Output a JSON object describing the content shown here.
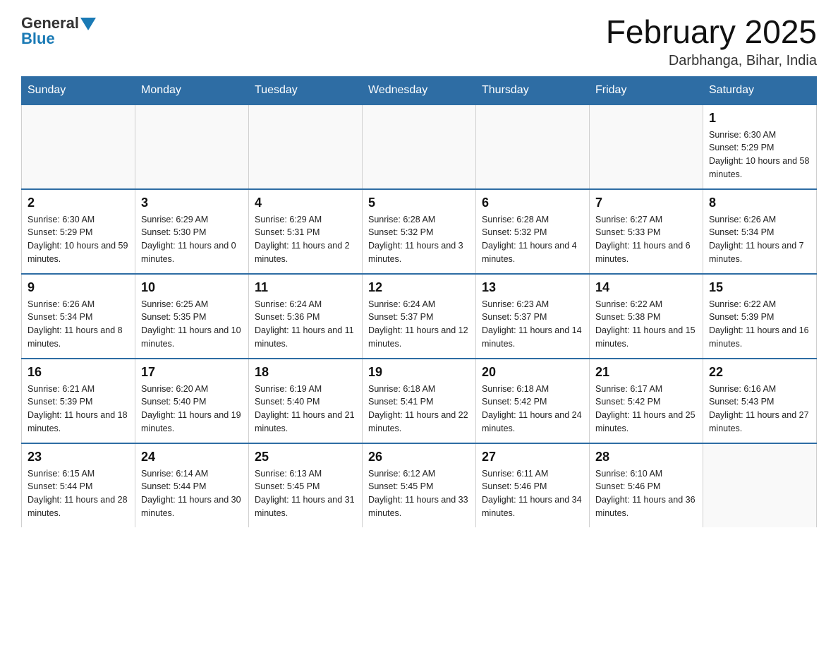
{
  "header": {
    "logo_general": "General",
    "logo_blue": "Blue",
    "month_title": "February 2025",
    "location": "Darbhanga, Bihar, India"
  },
  "weekdays": [
    "Sunday",
    "Monday",
    "Tuesday",
    "Wednesday",
    "Thursday",
    "Friday",
    "Saturday"
  ],
  "weeks": [
    [
      {
        "day": "",
        "sunrise": "",
        "sunset": "",
        "daylight": ""
      },
      {
        "day": "",
        "sunrise": "",
        "sunset": "",
        "daylight": ""
      },
      {
        "day": "",
        "sunrise": "",
        "sunset": "",
        "daylight": ""
      },
      {
        "day": "",
        "sunrise": "",
        "sunset": "",
        "daylight": ""
      },
      {
        "day": "",
        "sunrise": "",
        "sunset": "",
        "daylight": ""
      },
      {
        "day": "",
        "sunrise": "",
        "sunset": "",
        "daylight": ""
      },
      {
        "day": "1",
        "sunrise": "Sunrise: 6:30 AM",
        "sunset": "Sunset: 5:29 PM",
        "daylight": "Daylight: 10 hours and 58 minutes."
      }
    ],
    [
      {
        "day": "2",
        "sunrise": "Sunrise: 6:30 AM",
        "sunset": "Sunset: 5:29 PM",
        "daylight": "Daylight: 10 hours and 59 minutes."
      },
      {
        "day": "3",
        "sunrise": "Sunrise: 6:29 AM",
        "sunset": "Sunset: 5:30 PM",
        "daylight": "Daylight: 11 hours and 0 minutes."
      },
      {
        "day": "4",
        "sunrise": "Sunrise: 6:29 AM",
        "sunset": "Sunset: 5:31 PM",
        "daylight": "Daylight: 11 hours and 2 minutes."
      },
      {
        "day": "5",
        "sunrise": "Sunrise: 6:28 AM",
        "sunset": "Sunset: 5:32 PM",
        "daylight": "Daylight: 11 hours and 3 minutes."
      },
      {
        "day": "6",
        "sunrise": "Sunrise: 6:28 AM",
        "sunset": "Sunset: 5:32 PM",
        "daylight": "Daylight: 11 hours and 4 minutes."
      },
      {
        "day": "7",
        "sunrise": "Sunrise: 6:27 AM",
        "sunset": "Sunset: 5:33 PM",
        "daylight": "Daylight: 11 hours and 6 minutes."
      },
      {
        "day": "8",
        "sunrise": "Sunrise: 6:26 AM",
        "sunset": "Sunset: 5:34 PM",
        "daylight": "Daylight: 11 hours and 7 minutes."
      }
    ],
    [
      {
        "day": "9",
        "sunrise": "Sunrise: 6:26 AM",
        "sunset": "Sunset: 5:34 PM",
        "daylight": "Daylight: 11 hours and 8 minutes."
      },
      {
        "day": "10",
        "sunrise": "Sunrise: 6:25 AM",
        "sunset": "Sunset: 5:35 PM",
        "daylight": "Daylight: 11 hours and 10 minutes."
      },
      {
        "day": "11",
        "sunrise": "Sunrise: 6:24 AM",
        "sunset": "Sunset: 5:36 PM",
        "daylight": "Daylight: 11 hours and 11 minutes."
      },
      {
        "day": "12",
        "sunrise": "Sunrise: 6:24 AM",
        "sunset": "Sunset: 5:37 PM",
        "daylight": "Daylight: 11 hours and 12 minutes."
      },
      {
        "day": "13",
        "sunrise": "Sunrise: 6:23 AM",
        "sunset": "Sunset: 5:37 PM",
        "daylight": "Daylight: 11 hours and 14 minutes."
      },
      {
        "day": "14",
        "sunrise": "Sunrise: 6:22 AM",
        "sunset": "Sunset: 5:38 PM",
        "daylight": "Daylight: 11 hours and 15 minutes."
      },
      {
        "day": "15",
        "sunrise": "Sunrise: 6:22 AM",
        "sunset": "Sunset: 5:39 PM",
        "daylight": "Daylight: 11 hours and 16 minutes."
      }
    ],
    [
      {
        "day": "16",
        "sunrise": "Sunrise: 6:21 AM",
        "sunset": "Sunset: 5:39 PM",
        "daylight": "Daylight: 11 hours and 18 minutes."
      },
      {
        "day": "17",
        "sunrise": "Sunrise: 6:20 AM",
        "sunset": "Sunset: 5:40 PM",
        "daylight": "Daylight: 11 hours and 19 minutes."
      },
      {
        "day": "18",
        "sunrise": "Sunrise: 6:19 AM",
        "sunset": "Sunset: 5:40 PM",
        "daylight": "Daylight: 11 hours and 21 minutes."
      },
      {
        "day": "19",
        "sunrise": "Sunrise: 6:18 AM",
        "sunset": "Sunset: 5:41 PM",
        "daylight": "Daylight: 11 hours and 22 minutes."
      },
      {
        "day": "20",
        "sunrise": "Sunrise: 6:18 AM",
        "sunset": "Sunset: 5:42 PM",
        "daylight": "Daylight: 11 hours and 24 minutes."
      },
      {
        "day": "21",
        "sunrise": "Sunrise: 6:17 AM",
        "sunset": "Sunset: 5:42 PM",
        "daylight": "Daylight: 11 hours and 25 minutes."
      },
      {
        "day": "22",
        "sunrise": "Sunrise: 6:16 AM",
        "sunset": "Sunset: 5:43 PM",
        "daylight": "Daylight: 11 hours and 27 minutes."
      }
    ],
    [
      {
        "day": "23",
        "sunrise": "Sunrise: 6:15 AM",
        "sunset": "Sunset: 5:44 PM",
        "daylight": "Daylight: 11 hours and 28 minutes."
      },
      {
        "day": "24",
        "sunrise": "Sunrise: 6:14 AM",
        "sunset": "Sunset: 5:44 PM",
        "daylight": "Daylight: 11 hours and 30 minutes."
      },
      {
        "day": "25",
        "sunrise": "Sunrise: 6:13 AM",
        "sunset": "Sunset: 5:45 PM",
        "daylight": "Daylight: 11 hours and 31 minutes."
      },
      {
        "day": "26",
        "sunrise": "Sunrise: 6:12 AM",
        "sunset": "Sunset: 5:45 PM",
        "daylight": "Daylight: 11 hours and 33 minutes."
      },
      {
        "day": "27",
        "sunrise": "Sunrise: 6:11 AM",
        "sunset": "Sunset: 5:46 PM",
        "daylight": "Daylight: 11 hours and 34 minutes."
      },
      {
        "day": "28",
        "sunrise": "Sunrise: 6:10 AM",
        "sunset": "Sunset: 5:46 PM",
        "daylight": "Daylight: 11 hours and 36 minutes."
      },
      {
        "day": "",
        "sunrise": "",
        "sunset": "",
        "daylight": ""
      }
    ]
  ]
}
